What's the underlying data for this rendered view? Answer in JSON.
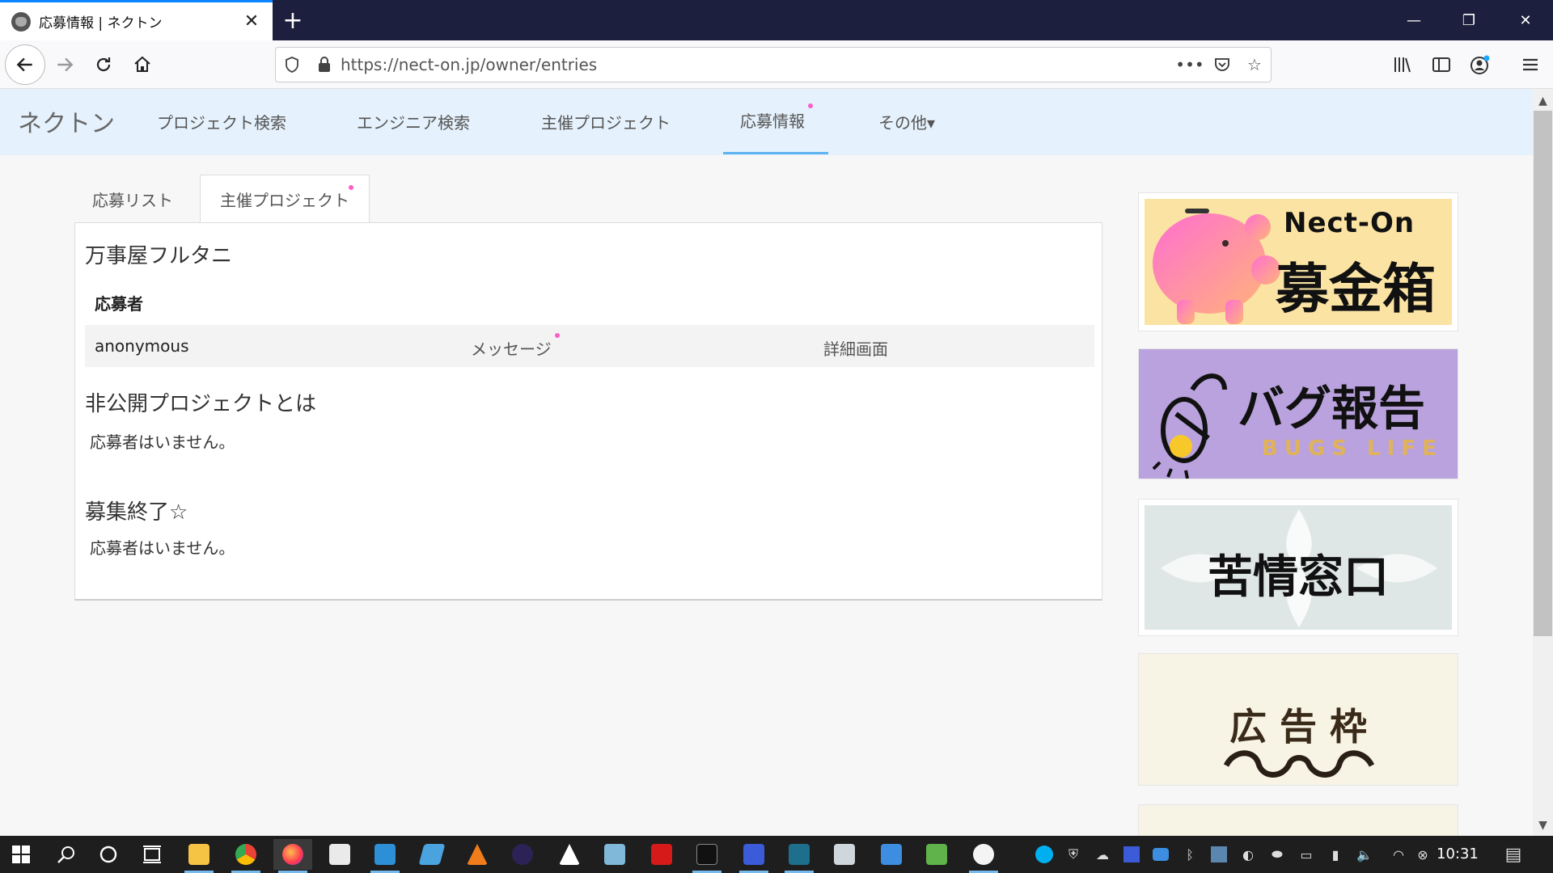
{
  "browser": {
    "tab_title": "応募情報 | ネクトン",
    "url": "https://nect-on.jp/owner/entries"
  },
  "site": {
    "brand": "ネクトン",
    "nav": [
      {
        "label": "プロジェクト検索"
      },
      {
        "label": "エンジニア検索"
      },
      {
        "label": "主催プロジェクト"
      },
      {
        "label": "応募情報"
      },
      {
        "label": "その他▾"
      }
    ]
  },
  "content": {
    "tabs": [
      {
        "label": "応募リスト"
      },
      {
        "label": "主催プロジェクト"
      }
    ],
    "sections": [
      {
        "title": "万事屋フルタニ",
        "applicants_heading": "応募者",
        "rows": [
          {
            "name": "anonymous",
            "message": "メッセージ",
            "detail": "詳細画面"
          }
        ]
      },
      {
        "title": "非公開プロジェクトとは",
        "empty": "応募者はいません。"
      },
      {
        "title": "募集終了☆",
        "empty": "応募者はいません。"
      }
    ]
  },
  "banners": [
    {
      "line1": "Nect-On",
      "line2": "募金箱",
      "bg": "#fbe4a3"
    },
    {
      "line1": "バグ報告",
      "line2": "BUGS LIFE",
      "bg": "#b9a2dd"
    },
    {
      "line1": "苦情窓口",
      "bg": "#dfe6e6"
    },
    {
      "line1": "広 告 枠",
      "bg": "#f7f4e6"
    }
  ],
  "taskbar": {
    "clock": "10:31"
  },
  "colors": {
    "accent": "#0a84ff",
    "header_bg": "#e5f1fc",
    "notification_dot": "#ff5ec4",
    "active_underline": "#5cb3f0"
  }
}
